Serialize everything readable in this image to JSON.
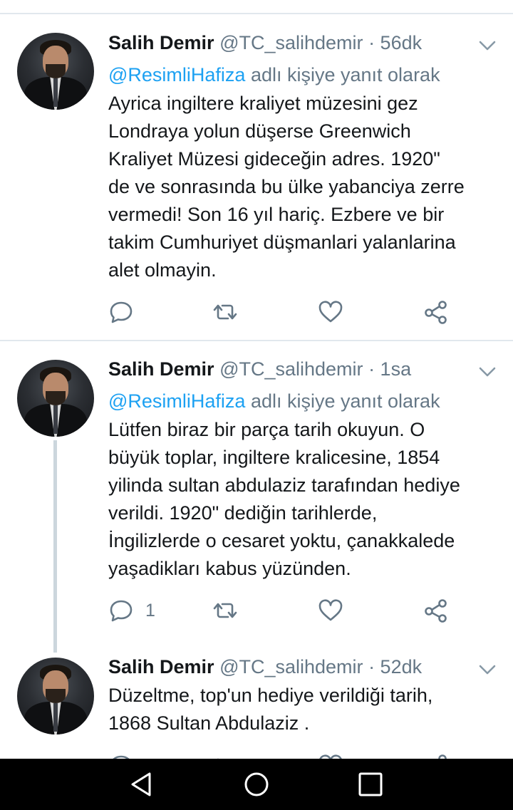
{
  "tweets": [
    {
      "name": "Salih Demir",
      "handle": "@TC_salihdemir",
      "time": "· 56dk",
      "reply_mention": "@ResimliHafiza",
      "reply_suffix": " adlı kişiye yanıt olarak",
      "text": "Ayrica ingiltere kraliyet müzesini gez\nLondraya yolun düşerse Greenwich\nKraliyet Müzesi gideceğin adres. 1920\"\nde ve sonrasında bu ülke yabanciya zerre\nvermedi! Son 16 yıl hariç. Ezbere ve bir\ntakim Cumhuriyet düşmanlari yalanlarina\nalet olmayin."
    },
    {
      "name": "Salih Demir",
      "handle": "@TC_salihdemir",
      "time": "· 1sa",
      "reply_mention": "@ResimliHafiza",
      "reply_suffix": " adlı kişiye yanıt olarak",
      "text": "Lütfen biraz bir parça tarih okuyun. O\nbüyük toplar, ingiltere kralicesine, 1854\nyilinda sultan abdulaziz tarafından hediye\nverildi. 1920\" dediğin tarihlerde,\nİngilizlerde o cesaret yoktu, çanakkalede\nyaşadikları kabus yüzünden.",
      "reply_count": "1"
    },
    {
      "name": "Salih Demir",
      "handle": "@TC_salihdemir",
      "time": "· 52dk",
      "text": "Düzeltme, top'un hediye verildiği tarih,\n1868 Sultan Abdulaziz ."
    }
  ],
  "colors": {
    "link": "#1da1f2",
    "muted": "#657786",
    "text": "#14171a",
    "divider": "#e1e8ed",
    "navbar": "#000000"
  },
  "icons": {
    "reply": "reply-icon",
    "retweet": "retweet-icon",
    "like": "heart-icon",
    "share": "share-icon",
    "more": "chevron-down-icon",
    "nav_back": "triangle-back-icon",
    "nav_home": "circle-home-icon",
    "nav_recents": "square-recents-icon"
  }
}
